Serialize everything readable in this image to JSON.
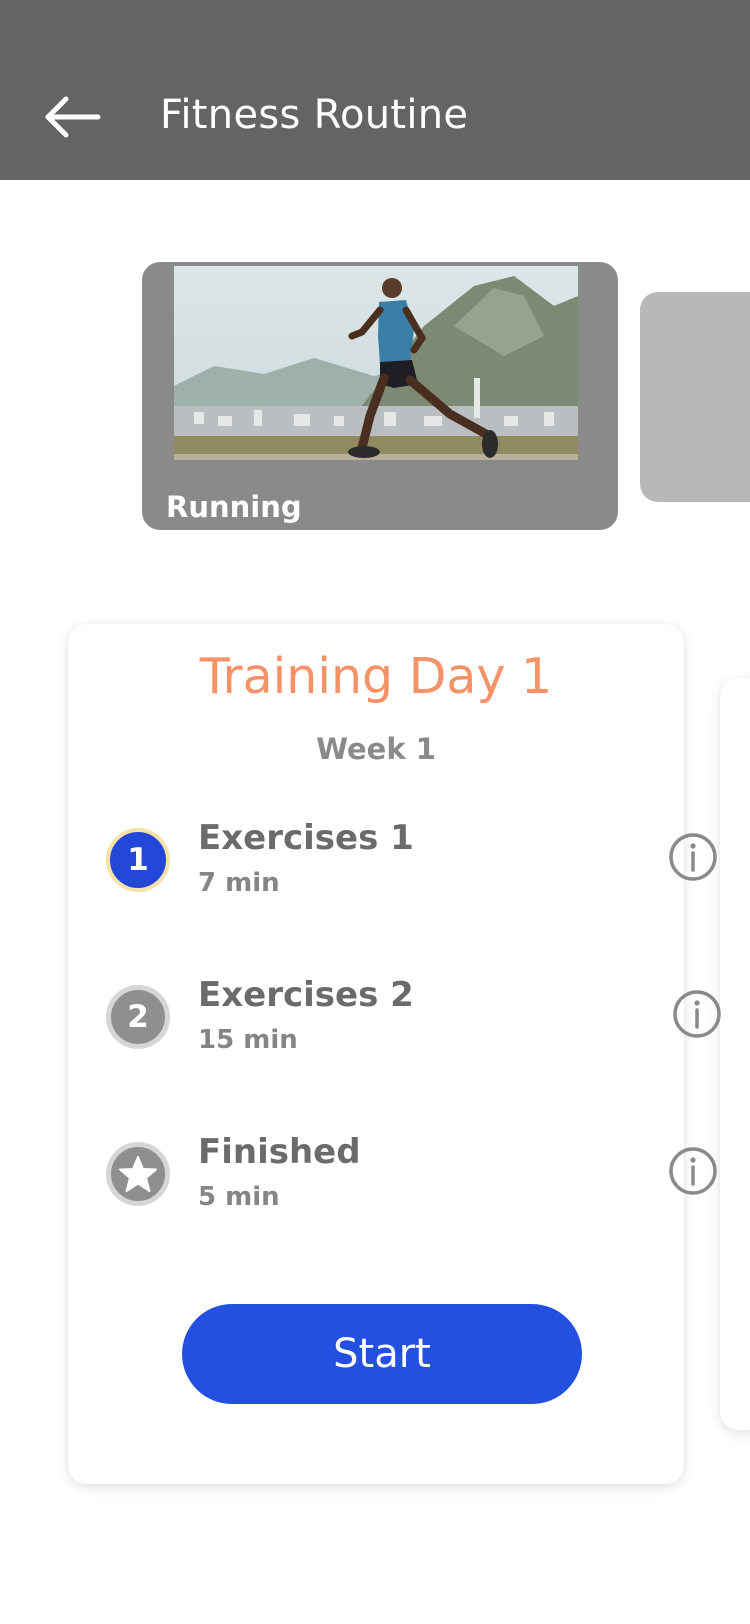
{
  "appbar": {
    "title": "Fitness Routine",
    "back_icon": "arrow-left-icon",
    "background": "#636466"
  },
  "carousel": {
    "slides": [
      {
        "caption": "Running",
        "image": "runner-photo"
      }
    ]
  },
  "training": {
    "title": "Training Day 1",
    "subtitle": "Week 1",
    "title_color": "#f59267",
    "steps": [
      {
        "badge": "1",
        "name": "Exercises 1",
        "time": "7 min",
        "state": "active"
      },
      {
        "badge": "2",
        "name": "Exercises 2",
        "time": "15 min",
        "state": "pending"
      },
      {
        "badge": "star-icon",
        "name": "Finished",
        "time": "5 min",
        "state": "pending"
      }
    ],
    "info_icon": "info-icon",
    "start_label": "Start",
    "accent": "#2350e0"
  }
}
